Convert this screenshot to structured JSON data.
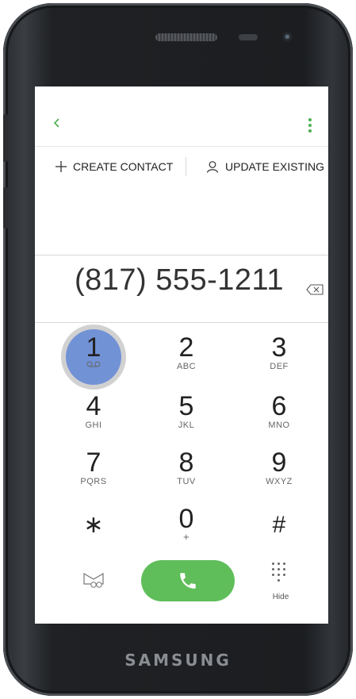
{
  "device": {
    "brand": "SAMSUNG"
  },
  "header": {
    "back_icon": "chevron-left-icon",
    "more_icon": "vertical-dots-icon",
    "accent": "#4caf50"
  },
  "actions": {
    "create_label": "CREATE CONTACT",
    "update_label": "UPDATE EXISTING"
  },
  "dialed_number": "(817) 555-1211",
  "keypad": [
    {
      "digit": "1",
      "letters": ""
    },
    {
      "digit": "2",
      "letters": "ABC"
    },
    {
      "digit": "3",
      "letters": "DEF"
    },
    {
      "digit": "4",
      "letters": "GHI"
    },
    {
      "digit": "5",
      "letters": "JKL"
    },
    {
      "digit": "6",
      "letters": "MNO"
    },
    {
      "digit": "7",
      "letters": "PQRS"
    },
    {
      "digit": "8",
      "letters": "TUV"
    },
    {
      "digit": "9",
      "letters": "WXYZ"
    },
    {
      "digit": "∗",
      "letters": ""
    },
    {
      "digit": "0",
      "letters": "+"
    },
    {
      "digit": "#",
      "letters": ""
    }
  ],
  "bottom_bar": {
    "hide_label": "Hide",
    "call_color": "#5fbe5a",
    "pressed_key_color": "#6d8ed6"
  }
}
